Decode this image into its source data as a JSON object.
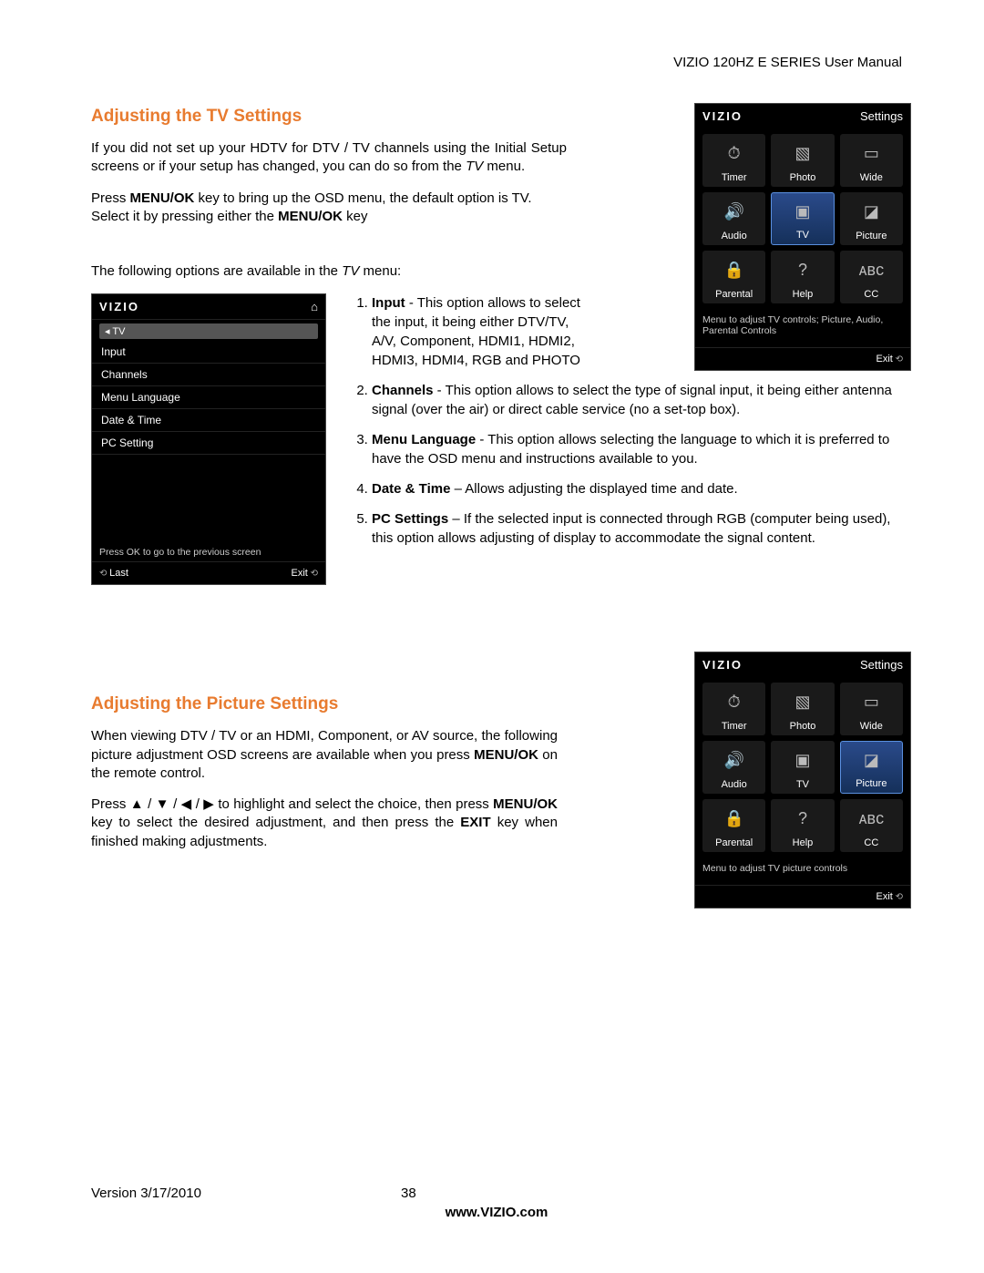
{
  "header": {
    "doc_title": "VIZIO 120HZ E SERIES User Manual"
  },
  "section1": {
    "heading": "Adjusting the TV Settings",
    "intro_a": "If you did not set up your HDTV for DTV / TV channels using the Initial Setup screens or if your setup has changed, you can do so from the ",
    "intro_b_italic": "TV",
    "intro_c": " menu.",
    "press_a": "Press ",
    "press_b_bold": "MENU/OK",
    "press_c": " key to bring up the OSD menu, the default option is TV. Select it by pressing either the ",
    "press_d_bold": "MENU/OK",
    "press_e": " key",
    "avail_a": "The following options are available in the ",
    "avail_b_italic": "TV",
    "avail_c": " menu:",
    "list": {
      "i1_label": "Input",
      "i1_sep": " -  ",
      "i1_text": "This option allows to select the input, it being either DTV/TV, A/V, Component, HDMI1, HDMI2, HDMI3, HDMI4, RGB and PHOTO",
      "i2_label": "Channels",
      "i2_sep": " - ",
      "i2_text": "This option allows to select the type of signal input, it being either antenna signal (over the air) or direct cable service (no a set-top box).",
      "i3_label": "Menu Language",
      "i3_sep": " - ",
      "i3_text": "This option allows selecting the language to which it is preferred to have the OSD menu and instructions available to you.",
      "i4_label": "Date & Time",
      "i4_sep": " – ",
      "i4_text": "Allows adjusting the displayed time and date.",
      "i5_label": "PC Settings",
      "i5_sep": " – ",
      "i5_text": "If the selected input is connected through RGB (computer being used), this option allows adjusting of display to accommodate the signal content."
    }
  },
  "section2": {
    "heading": "Adjusting the Picture Settings",
    "p1_a": "When viewing DTV / TV or an HDMI, Component, or AV source, the following picture adjustment OSD screens are available when you press ",
    "p1_b_bold": "MENU/OK",
    "p1_c": " on the remote control.",
    "p2_a": "Press ▲ / ▼ / ◀ / ▶ to highlight and select the choice, then press ",
    "p2_b_bold": "MENU/OK",
    "p2_c": " key to select the desired adjustment, and then press the ",
    "p2_d_bold": "EXIT",
    "p2_e": " key when finished making adjustments."
  },
  "osd_grid": {
    "brand": "VIZIO",
    "right_label": "Settings",
    "tiles": [
      {
        "label": "Timer",
        "icon": "⏱"
      },
      {
        "label": "Photo",
        "icon": "▧"
      },
      {
        "label": "Wide",
        "icon": "▭"
      },
      {
        "label": "Audio",
        "icon": "🔊"
      },
      {
        "label": "TV",
        "icon": "▣"
      },
      {
        "label": "Picture",
        "icon": "◪"
      },
      {
        "label": "Parental",
        "icon": "🔒"
      },
      {
        "label": "Help",
        "icon": "?"
      },
      {
        "label": "CC",
        "icon": "ᴀʙᴄ"
      }
    ],
    "hint1": "Menu to adjust TV controls; Picture, Audio, Parental Controls",
    "hint2": "Menu to adjust TV picture controls",
    "exit": "Exit"
  },
  "osd_tv_menu": {
    "brand": "VIZIO",
    "tab": "TV",
    "items": [
      "Input",
      "Channels",
      "Menu Language",
      "Date & Time",
      "PC Setting"
    ],
    "hint": "Press OK to go to the previous screen",
    "last": "Last",
    "exit": "Exit"
  },
  "footer": {
    "version": "Version 3/17/2010",
    "page": "38",
    "url": "www.VIZIO.com"
  }
}
